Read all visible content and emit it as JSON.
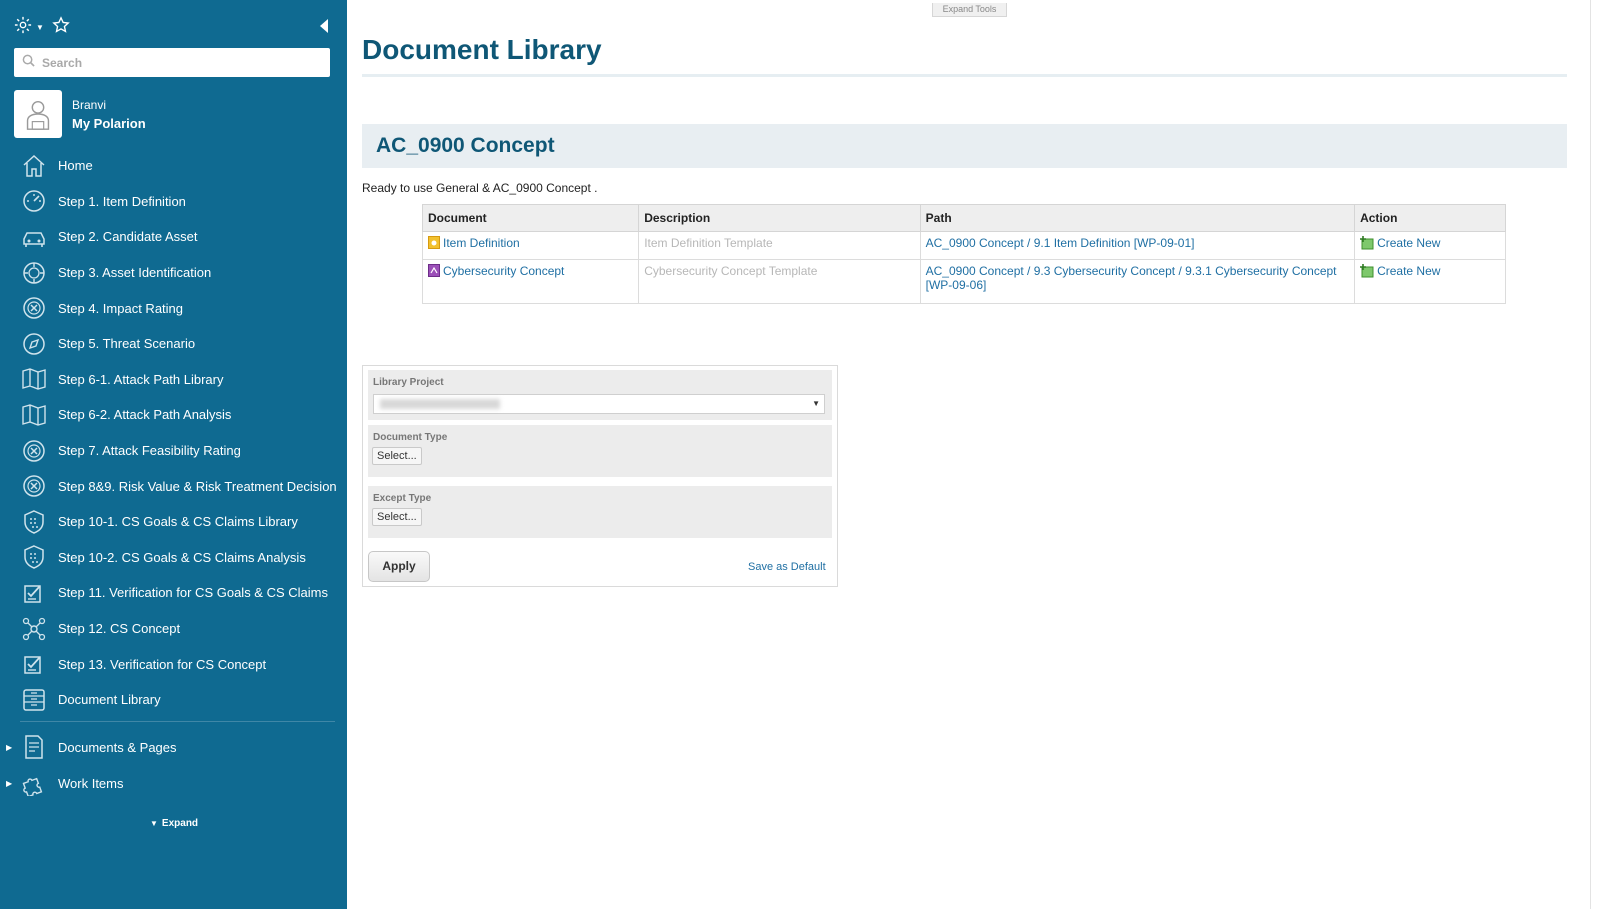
{
  "sidebar": {
    "search_placeholder": "Search",
    "user": {
      "name": "Branvi",
      "link": "My Polarion"
    },
    "items": [
      {
        "label": "Home",
        "icon": "home-icon"
      },
      {
        "label": "Step 1. Item Definition",
        "icon": "dashboard-icon"
      },
      {
        "label": "Step 2. Candidate Asset",
        "icon": "car-icon"
      },
      {
        "label": "Step 3. Asset Identification",
        "icon": "target-icon"
      },
      {
        "label": "Step 4. Impact Rating",
        "icon": "circle-x-icon"
      },
      {
        "label": "Step 5. Threat Scenario",
        "icon": "compass-icon"
      },
      {
        "label": "Step 6-1. Attack Path Library",
        "icon": "map-icon"
      },
      {
        "label": "Step 6-2. Attack Path Analysis",
        "icon": "map-icon"
      },
      {
        "label": "Step 7. Attack Feasibility Rating",
        "icon": "circle-x-icon"
      },
      {
        "label": "Step 8&9. Risk Value & Risk Treatment Decision",
        "icon": "circle-x-icon"
      },
      {
        "label": "Step 10-1. CS Goals & CS Claims Library",
        "icon": "shield-icon"
      },
      {
        "label": "Step 10-2. CS Goals & CS Claims Analysis",
        "icon": "shield-icon"
      },
      {
        "label": "Step 11. Verification for CS Goals & CS Claims",
        "icon": "checklist-icon"
      },
      {
        "label": "Step 12. CS Concept",
        "icon": "network-icon"
      },
      {
        "label": "Step 13. Verification for CS Concept",
        "icon": "checklist-icon"
      },
      {
        "label": "Document Library",
        "icon": "library-icon"
      }
    ],
    "groups": [
      {
        "label": "Documents & Pages",
        "icon": "document-icon"
      },
      {
        "label": "Work Items",
        "icon": "puzzle-icon"
      }
    ],
    "expand_label": "Expand"
  },
  "main": {
    "expand_tools": "Expand Tools",
    "title": "Document Library",
    "section_title": "AC_0900 Concept",
    "ready_text": "Ready to use General & AC_0900 Concept .",
    "table": {
      "headers": [
        "Document",
        "Description",
        "Path",
        "Action"
      ],
      "rows": [
        {
          "document": "Item Definition",
          "description": "Item Definition Template",
          "path": "AC_0900 Concept / 9.1 Item Definition [WP-09-01]",
          "action": "Create New"
        },
        {
          "document": "Cybersecurity Concept",
          "description": "Cybersecurity Concept Template",
          "path": "AC_0900 Concept / 9.3 Cybersecurity Concept / 9.3.1 Cybersecurity Concept [WP-09-06]",
          "action": "Create New"
        }
      ]
    },
    "filter": {
      "library_project_label": "Library Project",
      "document_type_label": "Document Type",
      "document_type_value": "Select...",
      "except_type_label": "Except Type",
      "except_type_value": "Select...",
      "apply_label": "Apply",
      "save_default_label": "Save as Default"
    }
  },
  "colors": {
    "sidebar_bg": "#0f6a91",
    "title": "#0f5776",
    "link": "#1f6fa3"
  }
}
